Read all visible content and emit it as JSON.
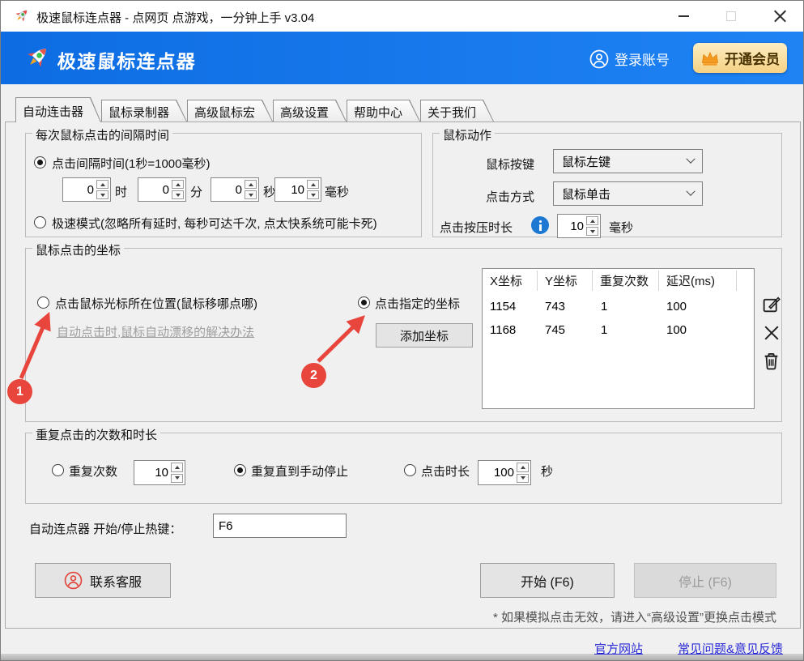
{
  "colors": {
    "header_bg": "#1173e8",
    "vip_gold": "#f5d184",
    "vip_text": "#4a3200",
    "annotation_red": "#e8453c",
    "link_blue": "#2929d6",
    "muted_link_gray": "#9e9e9e",
    "info_blue": "#1c78d3"
  },
  "icons": {
    "titlebar": "rocket-icon",
    "brand": "rocket-icon",
    "login": "user-circle-icon",
    "vip": "crown-icon",
    "press_info": "info-icon",
    "contact": "user-circle-icon",
    "row_actions": [
      "edit-icon",
      "close-icon",
      "trash-icon"
    ]
  },
  "window": {
    "title": "极速鼠标连点器 - 点网页 点游戏，一分钟上手 v3.04"
  },
  "header": {
    "brand": "极速鼠标连点器",
    "login_label": "登录账号",
    "vip_label": "开通会员"
  },
  "tabs": [
    {
      "label": "自动连击器",
      "active": true
    },
    {
      "label": "鼠标录制器",
      "active": false
    },
    {
      "label": "高级鼠标宏",
      "active": false
    },
    {
      "label": "高级设置",
      "active": false
    },
    {
      "label": "帮助中心",
      "active": false
    },
    {
      "label": "关于我们",
      "active": false
    }
  ],
  "interval_group": {
    "legend": "每次鼠标点击的间隔时间",
    "radio_interval": "点击间隔时间(1秒=1000毫秒)",
    "spinners": [
      {
        "value": "0",
        "unit": "时"
      },
      {
        "value": "0",
        "unit": "分"
      },
      {
        "value": "0",
        "unit": "秒"
      },
      {
        "value": "10",
        "unit": "毫秒"
      }
    ],
    "radio_turbo": "极速模式(忽略所有延时, 每秒可达千次, 点太快系统可能卡死)"
  },
  "action_group": {
    "legend": "鼠标动作",
    "button_label": "鼠标按键",
    "button_value": "鼠标左键",
    "mode_label": "点击方式",
    "mode_value": "鼠标单击",
    "press_label": "点击按压时长",
    "press_value": "10",
    "press_unit": "毫秒"
  },
  "coords_group": {
    "legend": "鼠标点击的坐标",
    "radio_cursor": "点击鼠标光标所在位置(鼠标移哪点哪)",
    "drift_link": "自动点击时,鼠标自动漂移的解决办法",
    "radio_fixed": "点击指定的坐标",
    "add_button": "添加坐标",
    "table": {
      "headers": [
        "X坐标",
        "Y坐标",
        "重复次数",
        "延迟(ms)"
      ],
      "rows": [
        [
          "1154",
          "743",
          "1",
          "100"
        ],
        [
          "1168",
          "745",
          "1",
          "100"
        ]
      ]
    },
    "badges": {
      "one": "1",
      "two": "2"
    }
  },
  "repeat_group": {
    "legend": "重复点击的次数和时长",
    "radio_count": "重复次数",
    "count_value": "10",
    "radio_manual": "重复直到手动停止",
    "radio_duration": "点击时长",
    "duration_value": "100",
    "duration_unit": "秒"
  },
  "hotkey": {
    "label": "自动连点器 开始/停止热键：",
    "value": "F6"
  },
  "footer": {
    "contact": "联系客服",
    "start": "开始 (F6)",
    "stop": "停止 (F6)",
    "note": "* 如果模拟点击无效，请进入“高级设置”更换点击模式",
    "link_site": "官方网站",
    "link_faq": "常见问题&意见反馈"
  }
}
